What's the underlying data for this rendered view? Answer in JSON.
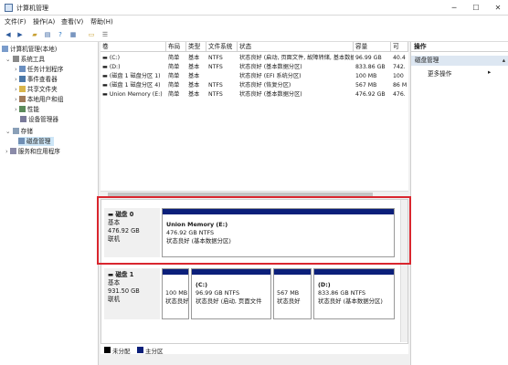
{
  "window": {
    "title": "计算机管理",
    "minimize": "─",
    "maximize": "☐",
    "close": "✕"
  },
  "menu": [
    "文件(F)",
    "操作(A)",
    "查看(V)",
    "帮助(H)"
  ],
  "tree": {
    "root": "计算机管理(本地)",
    "system_tools": "系统工具",
    "task_scheduler": "任务计划程序",
    "event_viewer": "事件查看器",
    "shared_folders": "共享文件夹",
    "local_users": "本地用户和组",
    "performance": "性能",
    "device_manager": "设备管理器",
    "storage": "存储",
    "disk_management": "磁盘管理",
    "services_apps": "服务和应用程序"
  },
  "volume_table": {
    "columns": [
      "卷",
      "布局",
      "类型",
      "文件系统",
      "状态",
      "容量",
      "可"
    ],
    "rows": [
      [
        "(C:)",
        "简单",
        "基本",
        "NTFS",
        "状态良好 (启动, 页面文件, 故障转储, 基本数据分区)",
        "96.99 GB",
        "40.4"
      ],
      [
        "(D:)",
        "简单",
        "基本",
        "NTFS",
        "状态良好 (基本数据分区)",
        "833.86 GB",
        "742."
      ],
      [
        "(磁盘 1 磁盘分区 1)",
        "简单",
        "基本",
        "",
        "状态良好 (EFI 系统分区)",
        "100 MB",
        "100"
      ],
      [
        "(磁盘 1 磁盘分区 4)",
        "简单",
        "基本",
        "NTFS",
        "状态良好 (恢复分区)",
        "567 MB",
        "86 M"
      ],
      [
        "Union Memory (E:)",
        "简单",
        "基本",
        "NTFS",
        "状态良好 (基本数据分区)",
        "476.92 GB",
        "476."
      ]
    ]
  },
  "actions": {
    "header": "操作",
    "section": "磁盘管理",
    "more": "更多操作"
  },
  "disks": [
    {
      "name": "磁盘 0",
      "type": "基本",
      "size": "476.92 GB",
      "status": "联机",
      "partitions": [
        {
          "name": "Union Memory  (E:)",
          "size": "476.92 GB NTFS",
          "status": "状态良好 (基本数据分区)"
        }
      ]
    },
    {
      "name": "磁盘 1",
      "type": "基本",
      "size": "931.50 GB",
      "status": "联机",
      "partitions": [
        {
          "name": "",
          "size": "100 MB",
          "status": "状态良好"
        },
        {
          "name": "(C:)",
          "size": "96.99 GB NTFS",
          "status": "状态良好 (启动, 页面文件"
        },
        {
          "name": "",
          "size": "567 MB",
          "status": "状态良好"
        },
        {
          "name": "(D:)",
          "size": "833.86 GB NTFS",
          "status": "状态良好 (基本数据分区)"
        }
      ]
    }
  ],
  "legend": [
    {
      "label": "未分配",
      "color": "#000000"
    },
    {
      "label": "主分区",
      "color": "#0b1f7a"
    }
  ],
  "colors": {
    "highlight": "#d9262e",
    "primary_partition": "#0b1f7a",
    "selection": "#cde6f7"
  }
}
